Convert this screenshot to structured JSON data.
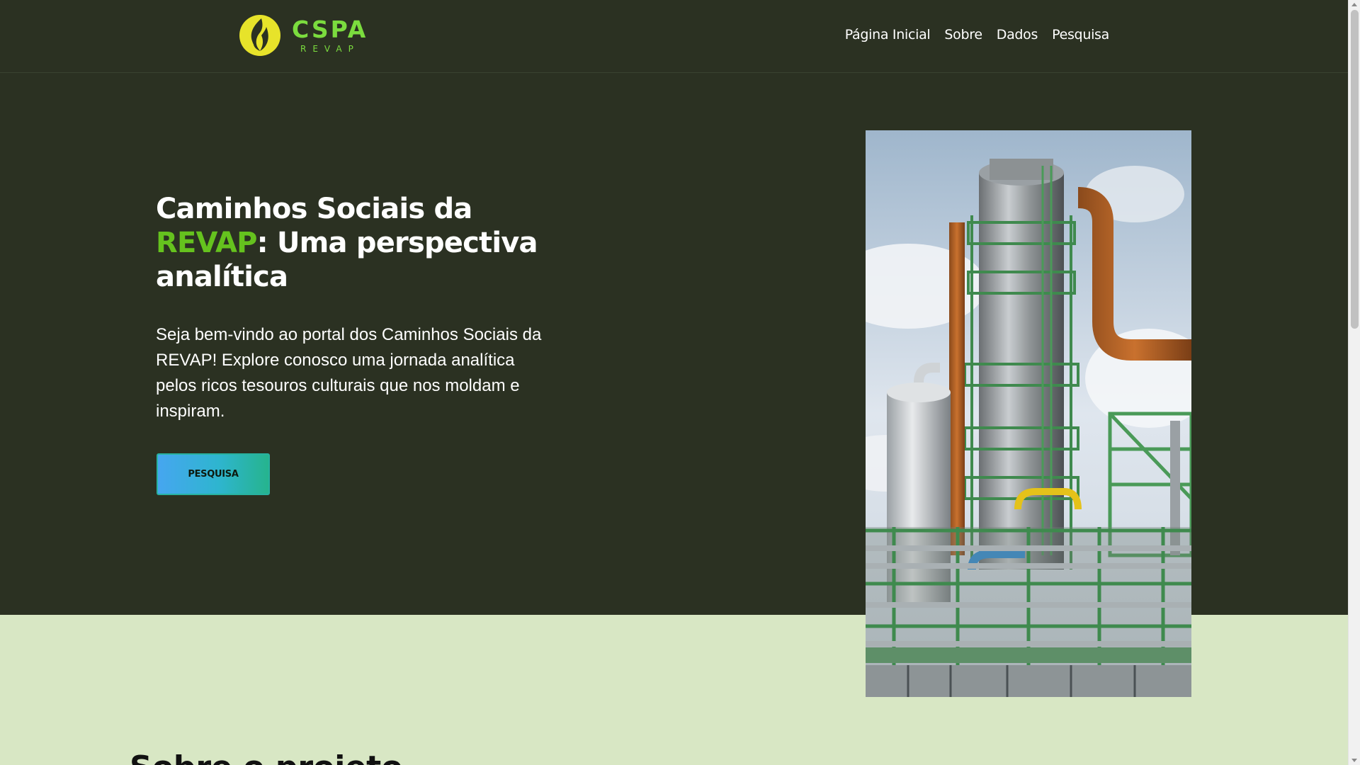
{
  "header": {
    "logo": {
      "title": "CSPA",
      "subtitle": "REVAP"
    },
    "nav": [
      {
        "label": "Página Inicial"
      },
      {
        "label": "Sobre"
      },
      {
        "label": "Dados"
      },
      {
        "label": "Pesquisa"
      }
    ]
  },
  "hero": {
    "title_prefix": "Caminhos Sociais da",
    "title_accent": "REVAP",
    "title_suffix": ": Uma perspectiva analítica",
    "description": "Seja bem-vindo ao portal dos Caminhos Sociais da REVAP! Explore conosco uma jornada analítica pelos ricos tesouros culturais que nos moldam e inspiram.",
    "cta_label": "PESQUISA",
    "image": "refinery-photo"
  },
  "next_section": {
    "heading": "Sobre o projeto"
  },
  "colors": {
    "header_bg": "#2b3122",
    "accent_green": "#65c21e",
    "logo_yellow": "#e7e32a",
    "section_bg": "#d8e7c4"
  }
}
